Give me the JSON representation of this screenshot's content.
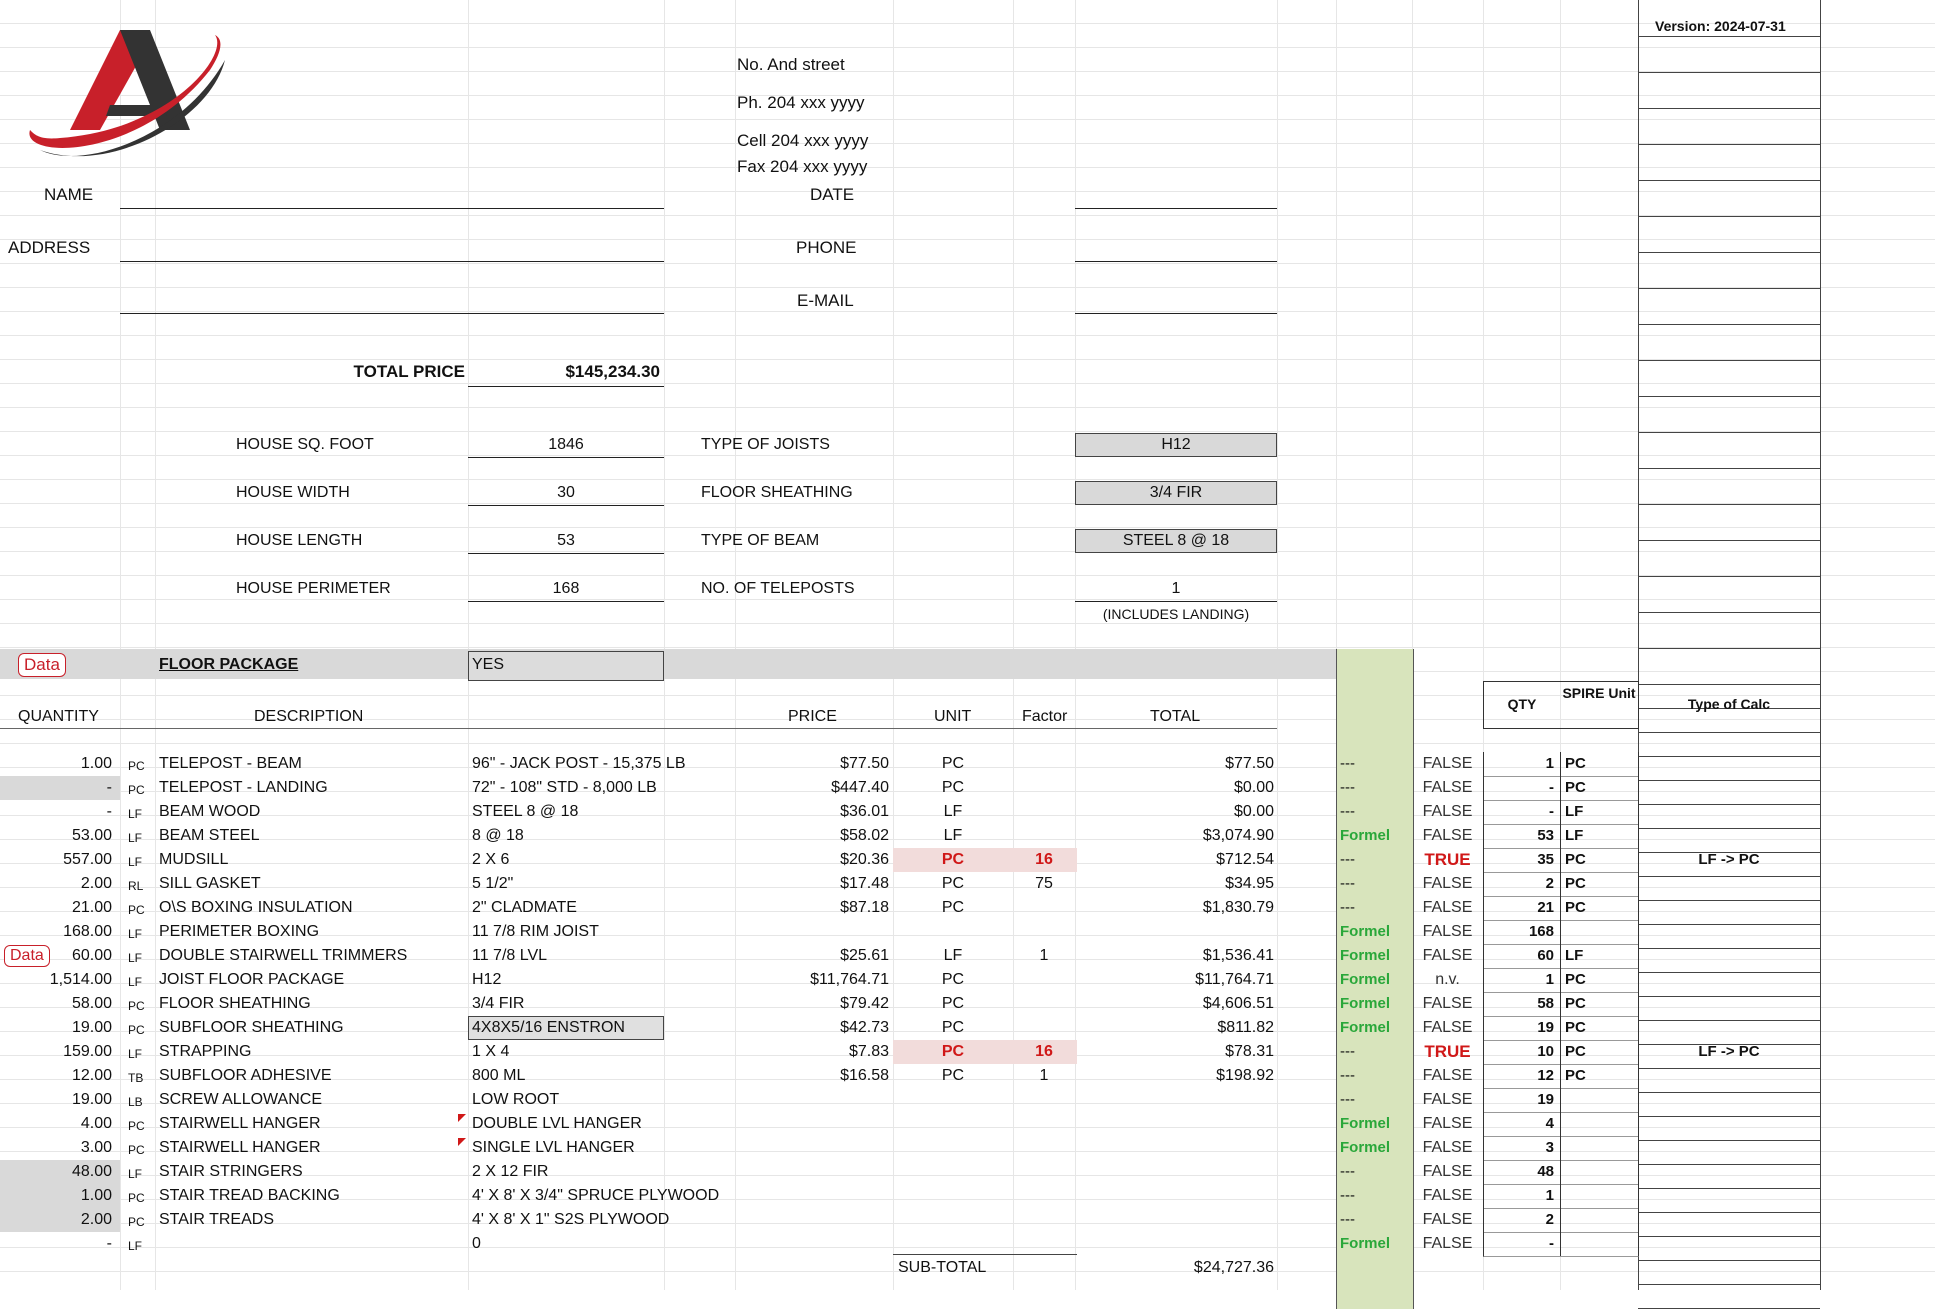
{
  "version": "Version: 2024-07-31",
  "company": {
    "street": "No. And street",
    "phone": "Ph.  204 xxx yyyy",
    "cell": "Cell 204 xxx yyyy",
    "fax": "Fax 204 xxx yyyy"
  },
  "customer_labels": {
    "name": "NAME",
    "date": "DATE",
    "address": "ADDRESS",
    "phone": "PHONE",
    "email": "E-MAIL"
  },
  "total": {
    "label": "TOTAL PRICE",
    "value": "$145,234.30"
  },
  "house": {
    "sqft_label": "HOUSE SQ. FOOT",
    "sqft": "1846",
    "width_label": "HOUSE WIDTH",
    "width": "30",
    "length_label": "HOUSE LENGTH",
    "length": "53",
    "perimeter_label": "HOUSE PERIMETER",
    "perimeter": "168"
  },
  "options": {
    "joists_label": "TYPE OF JOISTS",
    "joists": "H12",
    "sheathing_label": "FLOOR SHEATHING",
    "sheathing": "3/4 FIR",
    "beam_label": "TYPE OF BEAM",
    "beam": "STEEL 8 @ 18",
    "teleposts_label": "NO. OF TELEPOSTS",
    "teleposts": "1",
    "teleposts_note": "(INCLUDES LANDING)"
  },
  "package": {
    "data_btn": "Data",
    "title": "FLOOR PACKAGE",
    "value": "YES"
  },
  "headers": {
    "quantity": "QUANTITY",
    "description": "DESCRIPTION",
    "price": "PRICE",
    "unit": "UNIT",
    "factor": "Factor",
    "total": "TOTAL",
    "qty": "QTY",
    "spire_unit": "SPIRE Unit",
    "type_calc": "Type of Calc"
  },
  "rows": [
    {
      "qty": "1.00",
      "u": "PC",
      "desc": "TELEPOST - BEAM",
      "spec": "96\" - JACK POST - 15,375 LB",
      "price": "$77.50",
      "unit": "PC",
      "factor": "",
      "total": "$77.50",
      "f": "---",
      "bool": "FALSE",
      "q2": "1",
      "su": "PC",
      "calc": ""
    },
    {
      "qty": "-",
      "u": "PC",
      "desc": "TELEPOST - LANDING",
      "spec": "72\" - 108\"  STD - 8,000 LB",
      "price": "$447.40",
      "unit": "PC",
      "factor": "",
      "total": "$0.00",
      "f": "---",
      "bool": "FALSE",
      "q2": "-",
      "su": "PC",
      "calc": ""
    },
    {
      "qty": "-",
      "u": "LF",
      "desc": "BEAM WOOD",
      "spec": "STEEL 8 @ 18",
      "price": "$36.01",
      "unit": "LF",
      "factor": "",
      "total": "$0.00",
      "f": "---",
      "bool": "FALSE",
      "q2": "-",
      "su": "LF",
      "calc": ""
    },
    {
      "qty": "53.00",
      "u": "LF",
      "desc": "BEAM STEEL",
      "spec": "8 @ 18",
      "price": "$58.02",
      "unit": "LF",
      "factor": "",
      "total": "$3,074.90",
      "f": "Formel",
      "bool": "FALSE",
      "q2": "53",
      "su": "LF",
      "calc": ""
    },
    {
      "qty": "557.00",
      "u": "LF",
      "desc": "MUDSILL",
      "spec": "2 X 6",
      "price": "$20.36",
      "unit": "PC",
      "factor": "16",
      "total": "$712.54",
      "f": "---",
      "bool": "TRUE",
      "q2": "35",
      "su": "PC",
      "calc": "LF -> PC"
    },
    {
      "qty": "2.00",
      "u": "RL",
      "desc": "SILL GASKET",
      "spec": "5 1/2\"",
      "price": "$17.48",
      "unit": "PC",
      "factor": "75",
      "total": "$34.95",
      "f": "---",
      "bool": "FALSE",
      "q2": "2",
      "su": "PC",
      "calc": ""
    },
    {
      "qty": "21.00",
      "u": "PC",
      "desc": "O\\S BOXING INSULATION",
      "spec": "2\" CLADMATE",
      "price": "$87.18",
      "unit": "PC",
      "factor": "",
      "total": "$1,830.79",
      "f": "---",
      "bool": "FALSE",
      "q2": "21",
      "su": "PC",
      "calc": ""
    },
    {
      "qty": "168.00",
      "u": "LF",
      "desc": "PERIMETER BOXING",
      "spec": "11 7/8 RIM JOIST",
      "price": "",
      "unit": "",
      "factor": "",
      "total": "",
      "f": "Formel",
      "bool": "FALSE",
      "q2": "168",
      "su": "",
      "calc": ""
    },
    {
      "qty": "60.00",
      "u": "LF",
      "desc": "DOUBLE STAIRWELL TRIMMERS",
      "spec": "11 7/8 LVL",
      "price": "$25.61",
      "unit": "LF",
      "factor": "1",
      "total": "$1,536.41",
      "f": "Formel",
      "bool": "FALSE",
      "q2": "60",
      "su": "LF",
      "calc": ""
    },
    {
      "qty": "1,514.00",
      "u": "LF",
      "desc": "JOIST FLOOR PACKAGE",
      "spec": "H12",
      "price": "$11,764.71",
      "unit": "PC",
      "factor": "",
      "total": "$11,764.71",
      "f": "Formel",
      "bool": "n.v.",
      "q2": "1",
      "su": "PC",
      "calc": ""
    },
    {
      "qty": "58.00",
      "u": "PC",
      "desc": "FLOOR SHEATHING",
      "spec": "3/4 FIR",
      "price": "$79.42",
      "unit": "PC",
      "factor": "",
      "total": "$4,606.51",
      "f": "Formel",
      "bool": "FALSE",
      "q2": "58",
      "su": "PC",
      "calc": ""
    },
    {
      "qty": "19.00",
      "u": "PC",
      "desc": "SUBFLOOR SHEATHING",
      "spec": "4X8X5/16 ENSTRON",
      "price": "$42.73",
      "unit": "PC",
      "factor": "",
      "total": "$811.82",
      "f": "Formel",
      "bool": "FALSE",
      "q2": "19",
      "su": "PC",
      "calc": ""
    },
    {
      "qty": "159.00",
      "u": "LF",
      "desc": "STRAPPING",
      "spec": "1 X 4",
      "price": "$7.83",
      "unit": "PC",
      "factor": "16",
      "total": "$78.31",
      "f": "---",
      "bool": "TRUE",
      "q2": "10",
      "su": "PC",
      "calc": "LF -> PC"
    },
    {
      "qty": "12.00",
      "u": "TB",
      "desc": "SUBFLOOR ADHESIVE",
      "spec": "800 ML",
      "price": "$16.58",
      "unit": "PC",
      "factor": "1",
      "total": "$198.92",
      "f": "---",
      "bool": "FALSE",
      "q2": "12",
      "su": "PC",
      "calc": ""
    },
    {
      "qty": "19.00",
      "u": "LB",
      "desc": "SCREW ALLOWANCE",
      "spec": "LOW ROOT",
      "price": "",
      "unit": "",
      "factor": "",
      "total": "",
      "f": "---",
      "bool": "FALSE",
      "q2": "19",
      "su": "",
      "calc": ""
    },
    {
      "qty": "4.00",
      "u": "PC",
      "desc": "STAIRWELL HANGER",
      "spec": "DOUBLE LVL HANGER",
      "price": "",
      "unit": "",
      "factor": "",
      "total": "",
      "f": "Formel",
      "bool": "FALSE",
      "q2": "4",
      "su": "",
      "calc": ""
    },
    {
      "qty": "3.00",
      "u": "PC",
      "desc": "STAIRWELL HANGER",
      "spec": "SINGLE LVL HANGER",
      "price": "",
      "unit": "",
      "factor": "",
      "total": "",
      "f": "Formel",
      "bool": "FALSE",
      "q2": "3",
      "su": "",
      "calc": ""
    },
    {
      "qty": "48.00",
      "u": "LF",
      "desc": "STAIR STRINGERS",
      "spec": "2 X 12 FIR",
      "price": "",
      "unit": "",
      "factor": "",
      "total": "",
      "f": "---",
      "bool": "FALSE",
      "q2": "48",
      "su": "",
      "calc": ""
    },
    {
      "qty": "1.00",
      "u": "PC",
      "desc": "STAIR TREAD BACKING",
      "spec": "4' X 8' X 3/4\" SPRUCE PLYWOOD",
      "price": "",
      "unit": "",
      "factor": "",
      "total": "",
      "f": "---",
      "bool": "FALSE",
      "q2": "1",
      "su": "",
      "calc": ""
    },
    {
      "qty": "2.00",
      "u": "PC",
      "desc": "STAIR TREADS",
      "spec": "4' X 8' X 1\" S2S PLYWOOD",
      "price": "",
      "unit": "",
      "factor": "",
      "total": "",
      "f": "---",
      "bool": "FALSE",
      "q2": "2",
      "su": "",
      "calc": ""
    },
    {
      "qty": "-",
      "u": "LF",
      "desc": "",
      "spec": "0",
      "price": "",
      "unit": "",
      "factor": "",
      "total": "",
      "f": "Formel",
      "bool": "FALSE",
      "q2": "-",
      "su": "",
      "calc": ""
    }
  ],
  "row_data_btn": "Data",
  "subtotal": {
    "label": "SUB-TOTAL",
    "value": "$24,727.36"
  },
  "colors": {
    "formel": "#2aa73a",
    "true": "#d01818",
    "green_band": "#d8e4bc",
    "highlight": "#f2dcdb",
    "gray": "#d9d9d9",
    "logo_red": "#c8202a",
    "logo_dark": "#333333"
  }
}
